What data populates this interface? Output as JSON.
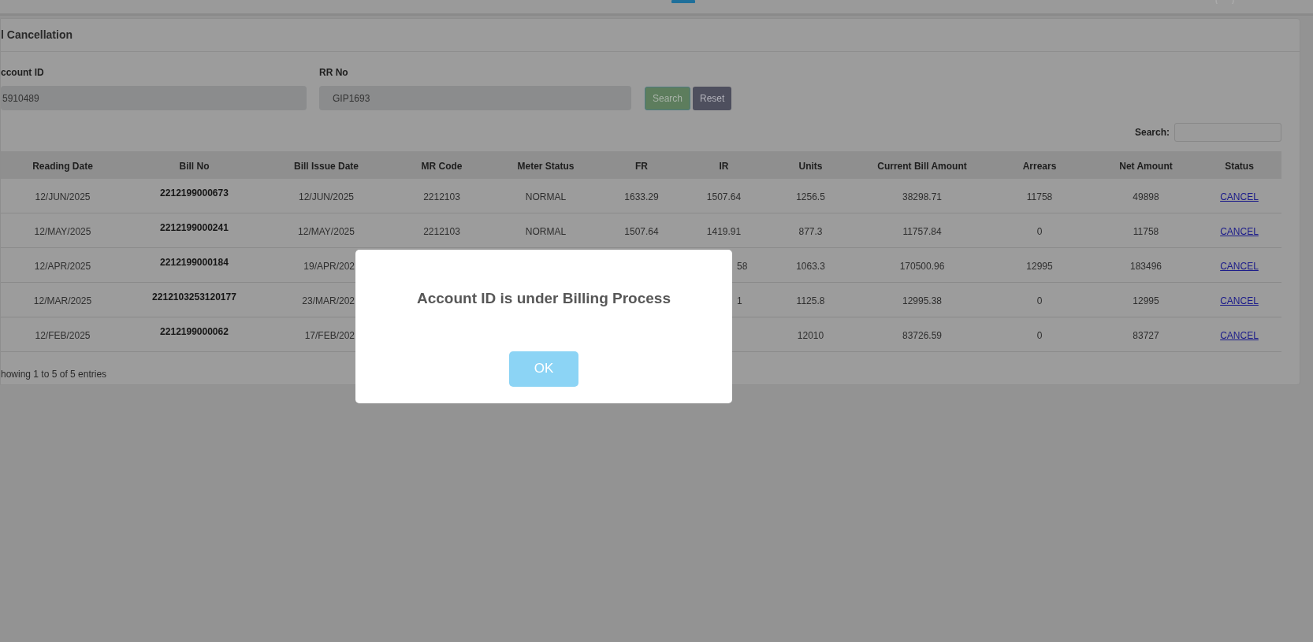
{
  "card": {
    "title": "l Cancellation"
  },
  "form": {
    "fields": [
      {
        "label": "ccount ID",
        "value": "5910489"
      },
      {
        "label": "RR No",
        "value": "GIP1693"
      }
    ],
    "buttons": [
      {
        "kind": "primary",
        "label": "Search"
      },
      {
        "kind": "secondary",
        "label": "Reset"
      }
    ]
  },
  "table_search": {
    "label": "Search:"
  },
  "table": {
    "columns": [
      "Reading Date",
      "Bill No",
      "Bill Issue Date",
      "MR Code",
      "Meter Status",
      "FR",
      "IR",
      "Units",
      "Current Bill Amount",
      "Arrears",
      "Net Amount",
      "Status"
    ],
    "rows": [
      {
        "reading_date": "12/JUN/2025",
        "bill_no": "2212199000673",
        "bill_issue_date": "12/JUN/2025",
        "mr_code": "2212103",
        "meter_status": "NORMAL",
        "fr": "1633.29",
        "ir": "1507.64",
        "units": "1256.5",
        "current_bill_amount": "38298.71",
        "arrears": "11758",
        "net_amount": "49898",
        "status": "CANCEL"
      },
      {
        "reading_date": "12/MAY/2025",
        "bill_no": "2212199000241",
        "bill_issue_date": "12/MAY/2025",
        "mr_code": "2212103",
        "meter_status": "NORMAL",
        "fr": "1507.64",
        "ir": "1419.91",
        "units": "877.3",
        "current_bill_amount": "11757.84",
        "arrears": "0",
        "net_amount": "11758",
        "status": "CANCEL"
      },
      {
        "reading_date": "12/APR/2025",
        "bill_no": "2212199000184",
        "bill_issue_date": "19/APR/202",
        "ir": "58",
        "units": "1063.3",
        "current_bill_amount": "170500.96",
        "arrears": "12995",
        "net_amount": "183496",
        "status": "CANCEL"
      },
      {
        "reading_date": "12/MAR/2025",
        "bill_no": "2212103253120177",
        "bill_issue_date": "23/MAR/202",
        "ir": "1",
        "units": "1125.8",
        "current_bill_amount": "12995.38",
        "arrears": "0",
        "net_amount": "12995",
        "status": "CANCEL"
      },
      {
        "reading_date": "12/FEB/2025",
        "bill_no": "2212199000062",
        "bill_issue_date": "17/FEB/202",
        "units": "12010",
        "current_bill_amount": "83726.59",
        "arrears": "0",
        "net_amount": "83727",
        "status": "CANCEL"
      }
    ]
  },
  "table_info": "howing 1 to 5 of 5 entries",
  "dialog": {
    "message": "Account ID is under Billing Process",
    "button": "OK"
  }
}
